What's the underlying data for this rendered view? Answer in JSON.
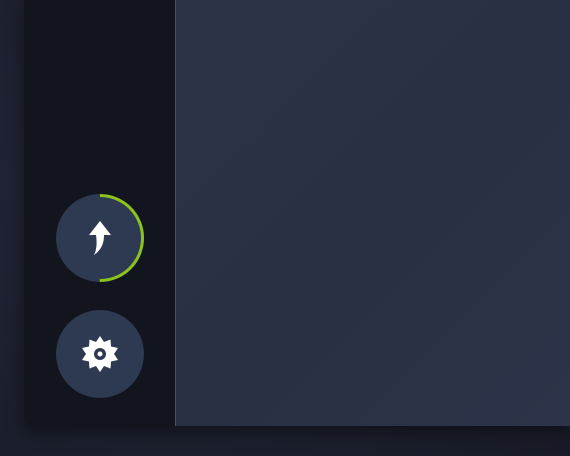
{
  "sidebar": {
    "upload_button": {
      "icon": "upload-arrow-icon",
      "progress": 0.5,
      "progress_color": "#8cc31a"
    },
    "settings_button": {
      "icon": "gear-icon"
    }
  },
  "colors": {
    "sidebar_bg": "#12151e",
    "main_bg": "#2a3246",
    "button_bg": "#2e3a52",
    "icon": "#ffffff",
    "accent": "#8cc31a"
  }
}
